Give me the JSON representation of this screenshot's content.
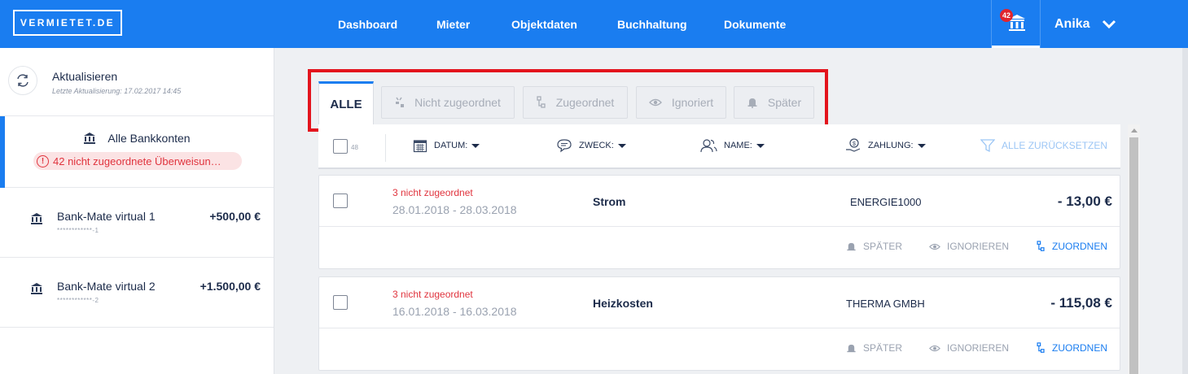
{
  "header": {
    "logo": "VERMIETET.DE",
    "nav": [
      {
        "label": "Dashboard"
      },
      {
        "label": "Mieter"
      },
      {
        "label": "Objektdaten"
      },
      {
        "label": "Buchhaltung"
      },
      {
        "label": "Dokumente"
      }
    ],
    "notification_count": "42",
    "user_name": "Anika"
  },
  "sidebar": {
    "refresh_label": "Aktualisieren",
    "last_update": "Letzte Aktualisierung: 17.02.2017 14:45",
    "all_accounts_label": "Alle Bankkonten",
    "unassigned_badge": "42 nicht zugeordnete Überweisun…",
    "accounts": [
      {
        "name": "Bank-Mate virtual 1",
        "iban": "************-1",
        "balance": "+500,00 €"
      },
      {
        "name": "Bank-Mate virtual 2",
        "iban": "************-2",
        "balance": "+1.500,00 €"
      }
    ]
  },
  "tabs": [
    {
      "label": "ALLE",
      "icon": "none",
      "active": true
    },
    {
      "label": "Nicht zugeordnet",
      "icon": "unlinked-icon"
    },
    {
      "label": "Zugeordnet",
      "icon": "linked-icon"
    },
    {
      "label": "Ignoriert",
      "icon": "eye-icon"
    },
    {
      "label": "Später",
      "icon": "bell-icon"
    }
  ],
  "filters": {
    "count": "48",
    "date": "DATUM:",
    "purpose": "ZWECK:",
    "name": "NAME:",
    "payment": "ZAHLUNG:",
    "reset": "ALLE ZURÜCKSETZEN"
  },
  "transactions": [
    {
      "status": "3 nicht zugeordnet",
      "dates": "28.01.2018 - 28.03.2018",
      "purpose": "Strom",
      "name": "ENERGIE1000",
      "amount": "- 13,00 €"
    },
    {
      "status": "3 nicht zugeordnet",
      "dates": "16.01.2018 - 16.03.2018",
      "purpose": "Heizkosten",
      "name": "THERMA GMBH",
      "amount": "- 115,08 €"
    }
  ],
  "actions": {
    "later": "SPÄTER",
    "ignore": "IGNORIEREN",
    "assign": "ZUORDNEN"
  },
  "colors": {
    "brand_blue": "#1a7df0",
    "alert_red": "#e0343e",
    "highlight_box": "#e3141d"
  }
}
